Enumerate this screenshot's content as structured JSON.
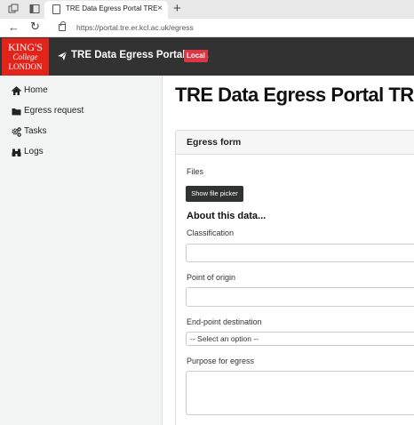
{
  "browser": {
    "tab_title": "TRE Data Egress Portal TRE",
    "tab_close": "×",
    "new_tab": "+",
    "url": "https://portal.tre.er.kcl.ac.uk/egress"
  },
  "navbar": {
    "logo": {
      "line1": "KING'S",
      "line2": "College",
      "line3": "LONDON"
    },
    "brand_title": "TRE Data Egress Portal TRE",
    "env_badge": "Local",
    "colors": {
      "navbar_bg": "#323232",
      "logo_bg": "#e2231a",
      "badge_bg": "#dc3545"
    }
  },
  "sidebar": {
    "items": [
      {
        "label": "Home",
        "icon": "home-icon"
      },
      {
        "label": "Egress request",
        "icon": "folder-icon"
      },
      {
        "label": "Tasks",
        "icon": "cogs-icon"
      },
      {
        "label": "Logs",
        "icon": "binoculars-icon"
      }
    ]
  },
  "main": {
    "page_title": "TRE Data Egress Portal TRE",
    "form": {
      "title": "Egress form",
      "files_label": "Files",
      "file_picker_label": "Show file picker",
      "section_heading": "About this data...",
      "classification_label": "Classification",
      "classification_value": "",
      "origin_label": "Point of origin",
      "origin_value": "",
      "destination_label": "End-point destination",
      "destination_selected": "-- Select an option --",
      "purpose_label": "Purpose for egress",
      "purpose_value": ""
    }
  }
}
